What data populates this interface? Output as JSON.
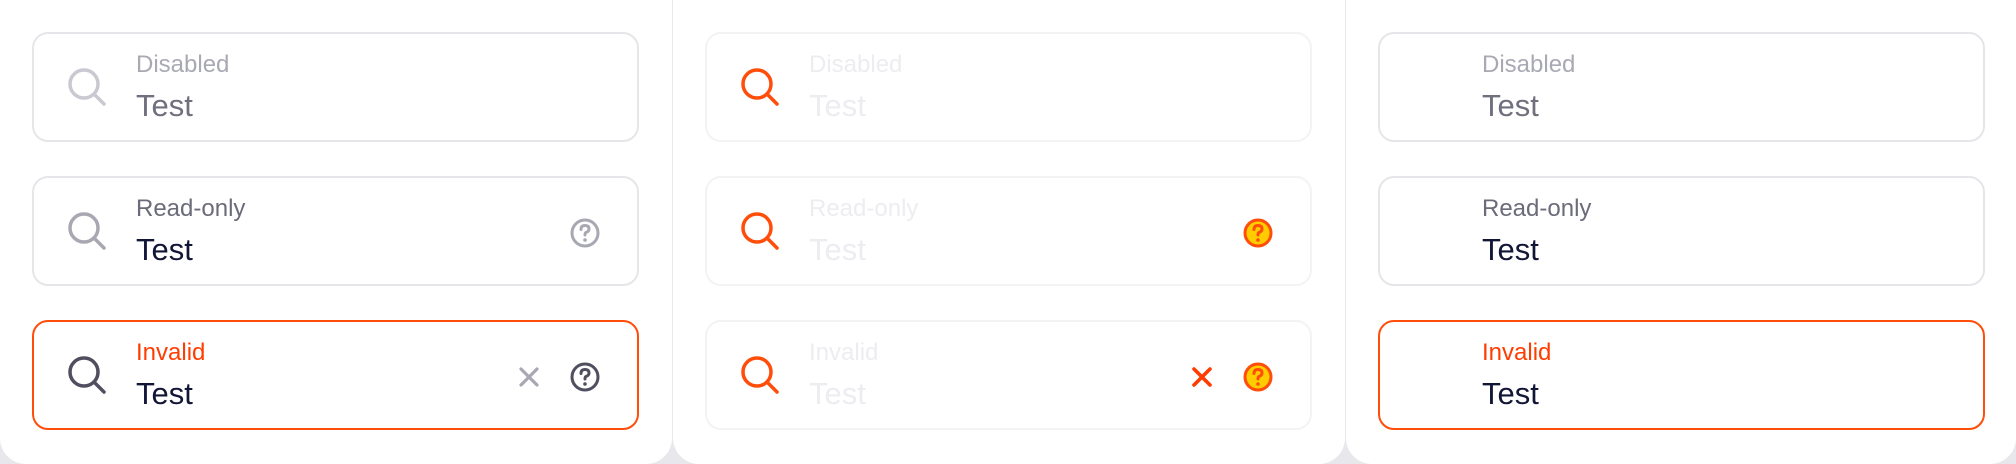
{
  "colors": {
    "accent": "#ff4d0a",
    "invalid_text": "#ff3d00",
    "text_dark": "#121636",
    "text_muted": "#6f6f7e",
    "icon_gray": "#a8a8b3",
    "icon_dark": "#4f4f60",
    "border": "#e6e6ea"
  },
  "panels": [
    {
      "fields": [
        {
          "label": "Disabled",
          "value": "Test",
          "leading_icon": "search-icon"
        },
        {
          "label": "Read-only",
          "value": "Test",
          "leading_icon": "search-icon",
          "trailing_icons": [
            "help-circle-icon"
          ]
        },
        {
          "label": "Invalid",
          "value": "Test",
          "leading_icon": "search-icon",
          "trailing_icons": [
            "close-icon",
            "help-circle-icon"
          ]
        }
      ]
    },
    {
      "fields": [
        {
          "label": "Disabled",
          "value": "Test",
          "leading_icon": "search-icon"
        },
        {
          "label": "Read-only",
          "value": "Test",
          "leading_icon": "search-icon",
          "trailing_icons": [
            "help-circle-icon"
          ]
        },
        {
          "label": "Invalid",
          "value": "Test",
          "leading_icon": "search-icon",
          "trailing_icons": [
            "close-icon",
            "help-circle-icon"
          ]
        }
      ]
    },
    {
      "fields": [
        {
          "label": "Disabled",
          "value": "Test"
        },
        {
          "label": "Read-only",
          "value": "Test"
        },
        {
          "label": "Invalid",
          "value": "Test"
        }
      ]
    }
  ]
}
